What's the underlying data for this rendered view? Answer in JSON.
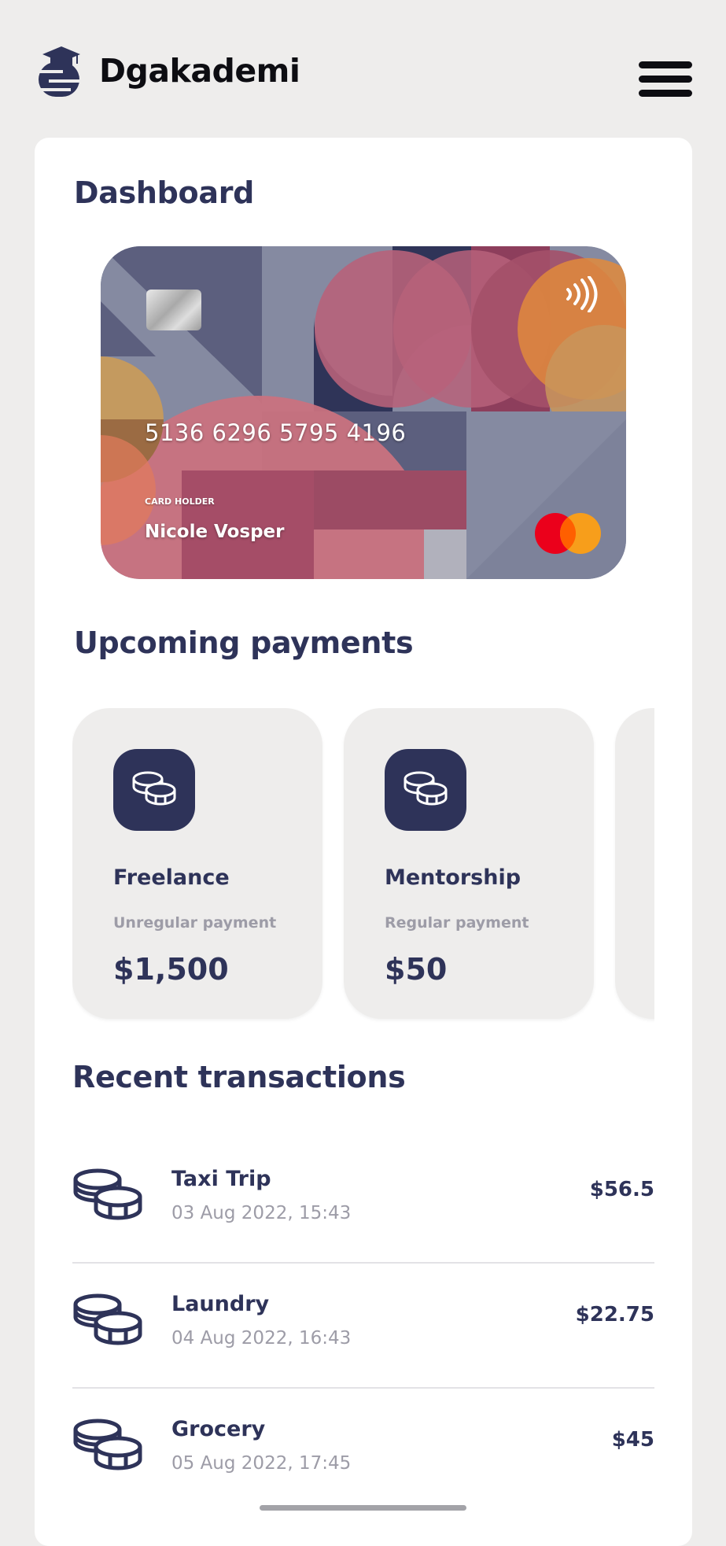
{
  "header": {
    "brand": "Dgakademi",
    "logo_icon": "graduation-cap-logo-icon",
    "menu_icon": "hamburger-menu-icon"
  },
  "dashboard": {
    "title": "Dashboard",
    "card": {
      "number": "5136 6296 5795 4196",
      "holder_label": "CARD HOLDER",
      "holder_name": "Nicole Vosper",
      "network_icon": "mastercard-logo-icon",
      "contactless_icon": "contactless-icon",
      "chip_icon": "chip-icon"
    }
  },
  "upcoming": {
    "title": "Upcoming payments",
    "items": [
      {
        "name": "Freelance",
        "type": "Unregular payment",
        "amount": "$1,500",
        "icon": "coins-icon"
      },
      {
        "name": "Mentorship",
        "type": "Regular payment",
        "amount": "$50",
        "icon": "coins-icon"
      }
    ]
  },
  "transactions": {
    "title": "Recent transactions",
    "items": [
      {
        "name": "Taxi Trip",
        "date": "03 Aug 2022, 15:43",
        "amount": "$56.5",
        "icon": "coins-icon"
      },
      {
        "name": "Laundry",
        "date": "04 Aug 2022, 16:43",
        "amount": "$22.75",
        "icon": "coins-icon"
      },
      {
        "name": "Grocery",
        "date": "05 Aug 2022, 17:45",
        "amount": "$45",
        "icon": "coins-icon"
      }
    ]
  },
  "colors": {
    "primary": "#2e3359",
    "background": "#eeedec",
    "muted_text": "#9d9ca7",
    "card_rose": "#c9727f",
    "card_orange": "#e08a3c"
  }
}
